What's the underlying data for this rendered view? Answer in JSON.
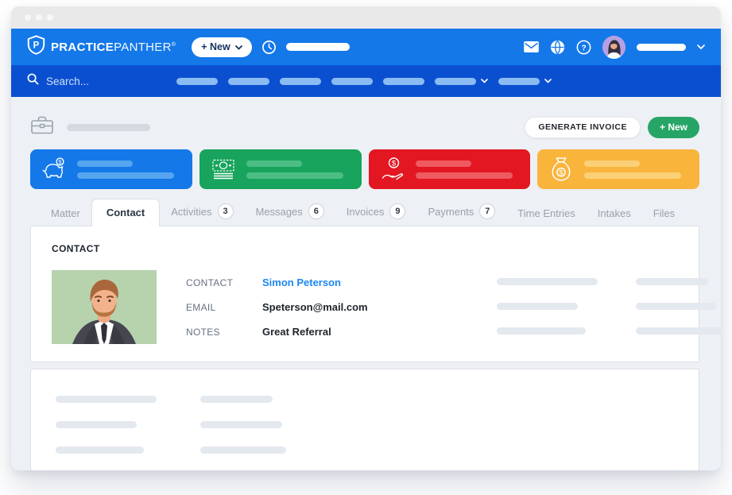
{
  "colors": {
    "header-blue": "#1478e9",
    "nav-blue": "#0b4fd1",
    "pill-blue": "#8abcf3",
    "green": "#27a567",
    "card-blue": "#1478e9",
    "card-green": "#18a45c",
    "card-red": "#e21722",
    "card-yellow": "#f9b43c",
    "link-blue": "#1d87f2",
    "main-bg": "#edf0f4"
  },
  "topbar": {
    "brand_bold": "PRACTICE",
    "brand_light": "PANTHER",
    "brand_reg": "®",
    "new_button": "+ New"
  },
  "navbar": {
    "search_placeholder": "Search..."
  },
  "toolbar": {
    "generate_invoice": "GENERATE INVOICE",
    "new_button": "+ New"
  },
  "tabs": [
    {
      "label": "Matter"
    },
    {
      "label": "Contact",
      "active": true
    },
    {
      "label": "Activities",
      "badge": "3"
    },
    {
      "label": "Messages",
      "badge": "6"
    },
    {
      "label": "Invoices",
      "badge": "9"
    },
    {
      "label": "Payments",
      "badge": "7"
    },
    {
      "label": "Time Entries"
    },
    {
      "label": "Intakes"
    },
    {
      "label": "Files"
    }
  ],
  "contact": {
    "section_title": "CONTACT",
    "fields": [
      {
        "label": "CONTACT",
        "value": "Simon Peterson",
        "link": true
      },
      {
        "label": "EMAIL",
        "value": "Speterson@mail.com"
      },
      {
        "label": "NOTES",
        "value": "Great Referral"
      }
    ]
  }
}
